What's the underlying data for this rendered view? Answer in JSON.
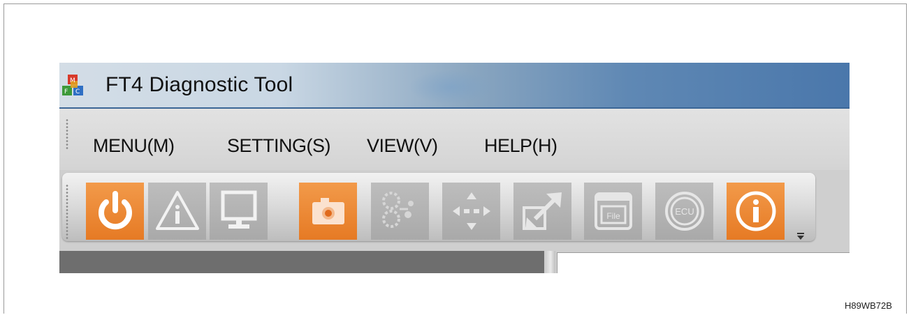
{
  "window": {
    "title": "FT4 Diagnostic Tool"
  },
  "menu": {
    "items": [
      {
        "label": "MENU(M)"
      },
      {
        "label": "SETTING(S)"
      },
      {
        "label": "VIEW(V)"
      },
      {
        "label": "HELP(H)"
      }
    ]
  },
  "toolbar": {
    "buttons": [
      {
        "icon": "power-icon",
        "state": "enabled"
      },
      {
        "icon": "warning-triangle-icon",
        "state": "disabled"
      },
      {
        "icon": "monitor-icon",
        "state": "disabled"
      },
      {
        "icon": "camera-icon",
        "state": "enabled"
      },
      {
        "icon": "gear-network-icon",
        "state": "disabled"
      },
      {
        "icon": "move-arrows-icon",
        "state": "disabled"
      },
      {
        "icon": "expand-arrows-icon",
        "state": "disabled"
      },
      {
        "icon": "file-icon",
        "state": "disabled",
        "text": "File"
      },
      {
        "icon": "ecu-icon",
        "state": "disabled",
        "text": "ECU"
      },
      {
        "icon": "info-icon",
        "state": "enabled"
      }
    ]
  },
  "figure_code": "H89WB72B",
  "colors": {
    "enabled": "#e67a24",
    "disabled": "#a9a9a9",
    "titlebar": "#4a77ab"
  }
}
